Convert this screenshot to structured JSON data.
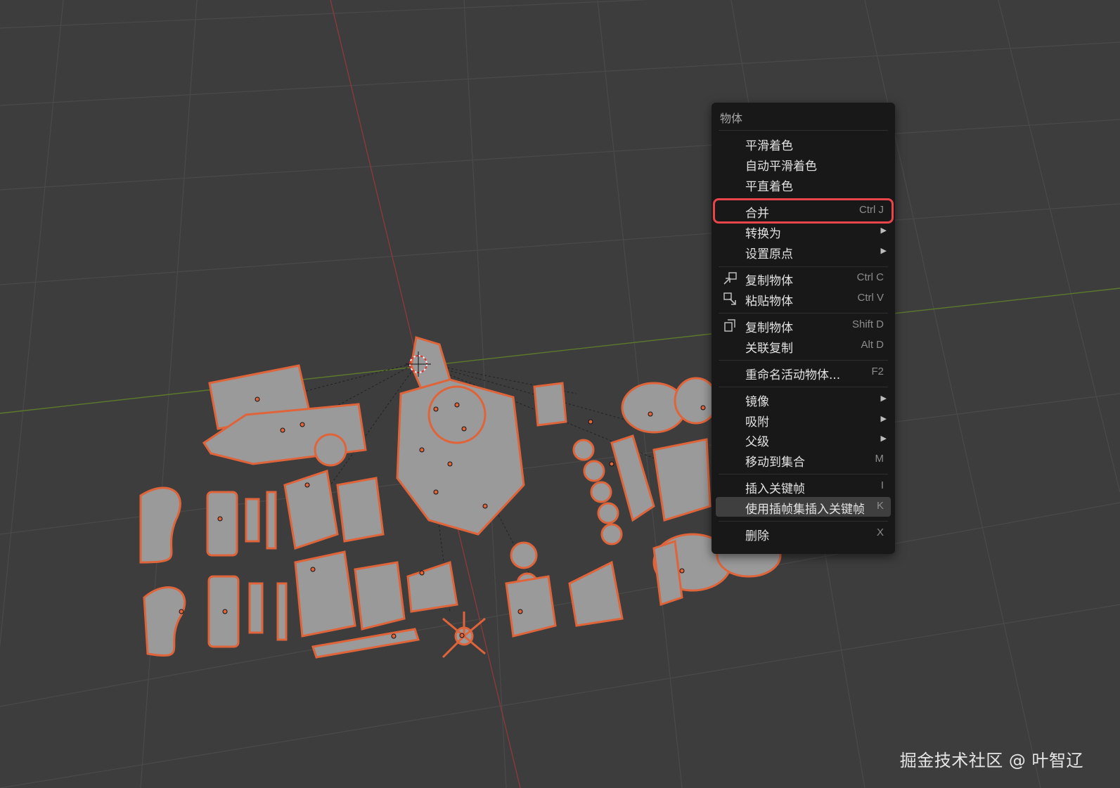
{
  "colors": {
    "viewport_bg": "#3d3d3d",
    "grid_line": "#4a4a4a",
    "x_axis": "#8b3a3a",
    "y_axis": "#5c7a2a",
    "selection_outline": "#e0643a",
    "object_fill": "#9a9a9a",
    "menu_bg": "#181818",
    "highlight_border": "#e8454a",
    "hover_bg": "#3f3f3f"
  },
  "menu": {
    "title": "物体",
    "items": [
      {
        "label": "平滑着色",
        "shortcut": "",
        "submenu": false,
        "icon": ""
      },
      {
        "label": "自动平滑着色",
        "shortcut": "",
        "submenu": false,
        "icon": ""
      },
      {
        "label": "平直着色",
        "shortcut": "",
        "submenu": false,
        "icon": ""
      },
      {
        "label": "合并",
        "shortcut": "Ctrl J",
        "submenu": false,
        "icon": "",
        "highlighted": true
      },
      {
        "label": "转换为",
        "shortcut": "",
        "submenu": true,
        "icon": ""
      },
      {
        "label": "设置原点",
        "shortcut": "",
        "submenu": true,
        "icon": ""
      },
      {
        "label": "复制物体",
        "shortcut": "Ctrl C",
        "submenu": false,
        "icon": "copy-object-icon"
      },
      {
        "label": "粘贴物体",
        "shortcut": "Ctrl V",
        "submenu": false,
        "icon": "paste-object-icon"
      },
      {
        "label": "复制物体",
        "shortcut": "Shift D",
        "submenu": false,
        "icon": "duplicate-icon"
      },
      {
        "label": "关联复制",
        "shortcut": "Alt D",
        "submenu": false,
        "icon": ""
      },
      {
        "label": "重命名活动物体...",
        "shortcut": "F2",
        "submenu": false,
        "icon": ""
      },
      {
        "label": "镜像",
        "shortcut": "",
        "submenu": true,
        "icon": ""
      },
      {
        "label": "吸附",
        "shortcut": "",
        "submenu": true,
        "icon": ""
      },
      {
        "label": "父级",
        "shortcut": "",
        "submenu": true,
        "icon": ""
      },
      {
        "label": "移动到集合",
        "shortcut": "M",
        "submenu": false,
        "icon": ""
      },
      {
        "label": "插入关键帧",
        "shortcut": "I",
        "submenu": false,
        "icon": ""
      },
      {
        "label": "使用插帧集插入关键帧",
        "shortcut": "K",
        "submenu": false,
        "icon": "",
        "hovered": true
      },
      {
        "label": "删除",
        "shortcut": "X",
        "submenu": false,
        "icon": ""
      }
    ]
  },
  "watermark": "掘金技术社区 @ 叶智辽"
}
